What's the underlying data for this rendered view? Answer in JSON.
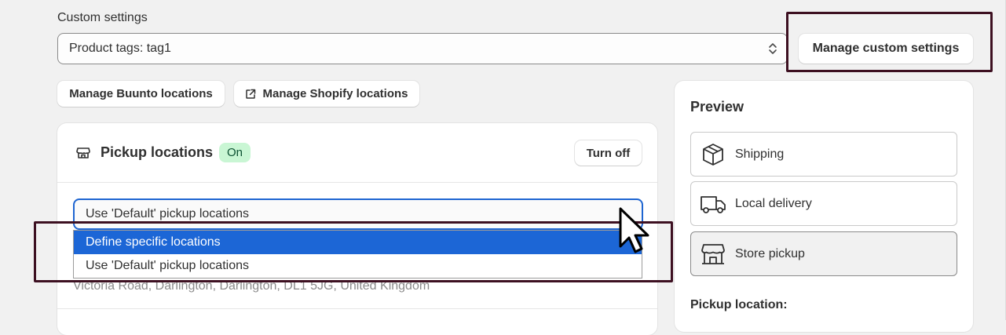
{
  "custom_settings": {
    "label": "Custom settings",
    "selected_value": "Product tags: tag1",
    "manage_button": "Manage custom settings"
  },
  "location_buttons": {
    "buunto": "Manage Buunto locations",
    "shopify": "Manage Shopify locations"
  },
  "pickup_card": {
    "title": "Pickup locations",
    "status_badge": "On",
    "turn_off_button": "Turn off",
    "dropdown_value": "Use 'Default' pickup locations",
    "options": [
      "Define specific locations",
      "Use 'Default' pickup locations"
    ],
    "selected_option_index": 0,
    "address": "Victoria Road, Darlington, Darlington, DL1 5JG, United Kingdom"
  },
  "preview": {
    "title": "Preview",
    "methods": [
      "Shipping",
      "Local delivery",
      "Store pickup"
    ],
    "active_method": "Store pickup",
    "pickup_location_label": "Pickup location:"
  },
  "colors": {
    "accent": "#1c66d6",
    "highlight": "#3d1021",
    "badge_bg": "#c9f6d4"
  },
  "icons": [
    "chevron-updown-icon",
    "external-link-icon",
    "store-icon",
    "box-icon",
    "truck-icon",
    "storefront-icon",
    "cursor-icon"
  ]
}
